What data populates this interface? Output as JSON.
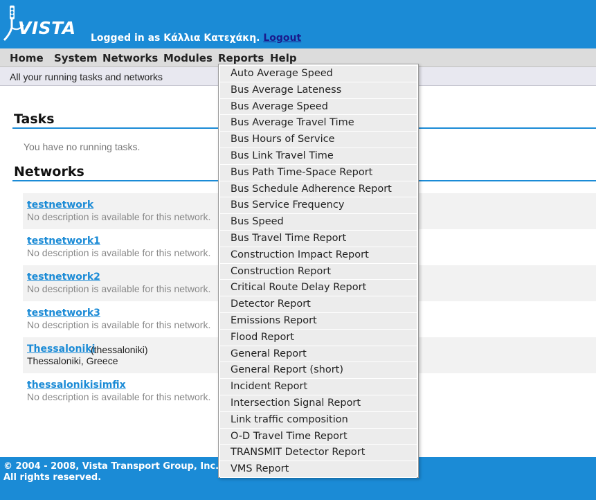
{
  "header": {
    "logo_text": "VISTA",
    "logged_in_text": "Logged in as Κάλλια Κατεχάκη.",
    "logout_label": "Logout"
  },
  "menu": {
    "items": [
      "Home",
      "System",
      "Networks",
      "Modules",
      "Reports",
      "Help"
    ]
  },
  "subheader": {
    "text": "All your running tasks and networks"
  },
  "tasks": {
    "title": "Tasks",
    "empty_text": "You have no running tasks."
  },
  "networks": {
    "title": "Networks",
    "items": [
      {
        "name": "testnetwork",
        "extra": "",
        "description": "No description is available for this network."
      },
      {
        "name": "testnetwork1",
        "extra": "",
        "description": "No description is available for this network."
      },
      {
        "name": "testnetwork2",
        "extra": "",
        "description": "No description is available for this network."
      },
      {
        "name": "testnetwork3",
        "extra": "",
        "description": "No description is available for this network."
      },
      {
        "name": "Thessaloniki",
        "extra": "(thessaloniki)",
        "description": "Thessaloniki, Greece"
      },
      {
        "name": "thessalonikisimfix",
        "extra": "",
        "description": "No description is available for this network."
      }
    ]
  },
  "reports_dropdown": {
    "items": [
      "Auto Average Speed",
      "Bus Average Lateness",
      "Bus Average Speed",
      "Bus Average Travel Time",
      "Bus Hours of Service",
      "Bus Link Travel Time",
      "Bus Path Time-Space Report",
      "Bus Schedule Adherence Report",
      "Bus Service Frequency",
      "Bus Speed",
      "Bus Travel Time Report",
      "Construction Impact Report",
      "Construction Report",
      "Critical Route Delay Report",
      "Detector Report",
      "Emissions Report",
      "Flood Report",
      "General Report",
      "General Report (short)",
      "Incident Report",
      "Intersection Signal Report",
      "Link traffic composition",
      "O-D Travel Time Report",
      "TRANSMIT Detector Report",
      "VMS Report"
    ]
  },
  "footer": {
    "line1": "© 2004 - 2008, Vista Transport Group, Inc.",
    "line2": "All rights reserved."
  },
  "colors": {
    "brand_blue": "#1b8bd6",
    "menubar_gray": "#dcdcdc",
    "link_blue": "#1b8bd6"
  },
  "icons": {
    "logo": "traffic-light-pole-icon"
  }
}
